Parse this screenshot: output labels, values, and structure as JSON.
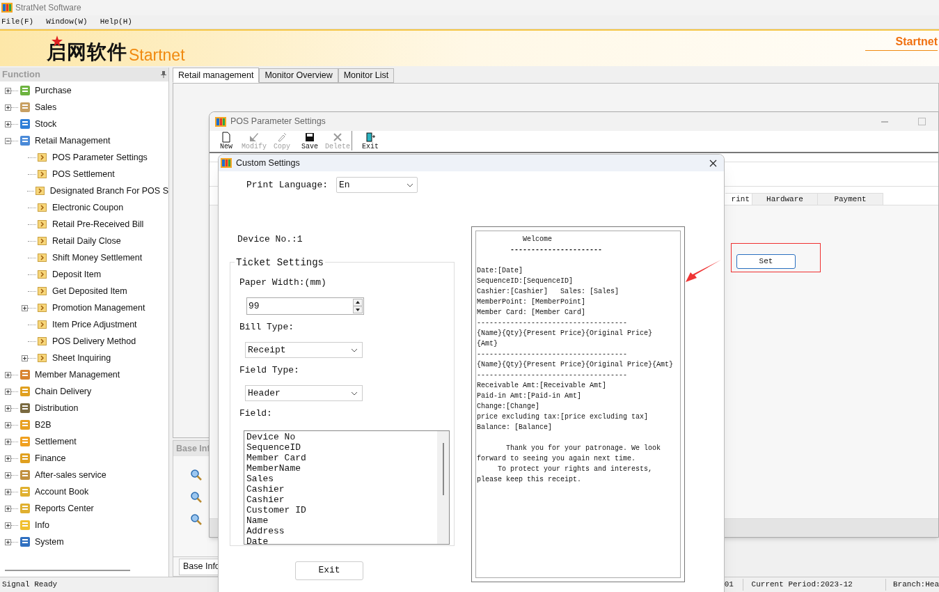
{
  "app": {
    "title": "StratNet Software"
  },
  "menu": [
    "File(F)",
    "Window(W)",
    "Help(H)"
  ],
  "banner": {
    "logo_cn": "启网软件",
    "logo_en": "Startnet",
    "right_text": "Startnet"
  },
  "sidebar": {
    "title": "Function",
    "items": [
      {
        "label": "Purchase",
        "expanded": false
      },
      {
        "label": "Sales",
        "expanded": false
      },
      {
        "label": "Stock",
        "expanded": false
      },
      {
        "label": "Retail Management",
        "expanded": true,
        "children": [
          {
            "label": "POS Parameter Settings",
            "expandable": false
          },
          {
            "label": "POS Settlement",
            "expandable": false
          },
          {
            "label": "Designated Branch For POS S",
            "expandable": false
          },
          {
            "label": "Electronic Coupon",
            "expandable": false
          },
          {
            "label": "Retail Pre-Received Bill",
            "expandable": false
          },
          {
            "label": "Retail Daily Close",
            "expandable": false
          },
          {
            "label": "Shift Money Settlement",
            "expandable": false
          },
          {
            "label": "Deposit Item",
            "expandable": false
          },
          {
            "label": "Get Deposited Item",
            "expandable": false
          },
          {
            "label": "Promotion Management",
            "expandable": true
          },
          {
            "label": "Item Price Adjustment",
            "expandable": false
          },
          {
            "label": "POS Delivery Method",
            "expandable": false
          },
          {
            "label": "Sheet Inquiring",
            "expandable": true
          }
        ]
      },
      {
        "label": "Member Management",
        "expanded": false
      },
      {
        "label": "Chain Delivery",
        "expanded": false
      },
      {
        "label": "Distribution",
        "expanded": false
      },
      {
        "label": "B2B",
        "expanded": false
      },
      {
        "label": "Settlement",
        "expanded": false
      },
      {
        "label": "Finance",
        "expanded": false
      },
      {
        "label": "After-sales service",
        "expanded": false
      },
      {
        "label": "Account Book",
        "expanded": false
      },
      {
        "label": "Reports Center",
        "expanded": false
      },
      {
        "label": "Info",
        "expanded": false
      },
      {
        "label": "System",
        "expanded": false
      }
    ]
  },
  "tabs": [
    {
      "label": "Retail management",
      "selected": true
    },
    {
      "label": "Monitor Overview",
      "selected": false
    },
    {
      "label": "Monitor List",
      "selected": false
    }
  ],
  "base_info": {
    "title": "Base Inf",
    "tab": "Base Info"
  },
  "pos_window": {
    "title": "POS Parameter Settings",
    "toolbar": [
      {
        "label": "New",
        "disabled": false
      },
      {
        "label": "Modify",
        "disabled": true
      },
      {
        "label": "Copy",
        "disabled": true
      },
      {
        "label": "Save",
        "disabled": false
      },
      {
        "label": "Delete",
        "disabled": true
      },
      {
        "label": "Exit",
        "disabled": false
      }
    ],
    "tabs": [
      {
        "label": "rint",
        "selected": true
      },
      {
        "label": "Hardware",
        "selected": false
      },
      {
        "label": "Payment",
        "selected": false
      }
    ],
    "set_button": "Set"
  },
  "dialog": {
    "title": "Custom Settings",
    "print_language": {
      "label": "Print Language:",
      "value": "En"
    },
    "device_no": "Device No.:1",
    "ticket_settings": {
      "title": "Ticket Settings",
      "paper_width": {
        "label": "Paper Width:(mm)",
        "value": "99"
      },
      "bill_type": {
        "label": "Bill Type:",
        "value": "Receipt"
      },
      "field_type": {
        "label": "Field Type:",
        "value": "Header"
      },
      "field": {
        "label": "Field:",
        "items": [
          "Device No",
          "SequenceID",
          "Member Card",
          "MemberName",
          "Sales",
          "Cashier",
          "Cashier",
          "Customer ID",
          "Name",
          "Address",
          "Date"
        ]
      }
    },
    "exit_button": "Exit",
    "receipt": [
      {
        "kind": "title",
        "text": "Welcome"
      },
      {
        "kind": "heading_rule",
        "text": "----------------------"
      },
      {
        "kind": "gap"
      },
      {
        "kind": "text",
        "text": "Date:[Date]"
      },
      {
        "kind": "text",
        "text": "SequenceID:[SequenceID]"
      },
      {
        "kind": "text",
        "text": "Cashier:[Cashier]   Sales: [Sales]"
      },
      {
        "kind": "text",
        "text": "MemberPoint: [MemberPoint]"
      },
      {
        "kind": "text",
        "text": "Member Card: [Member Card]"
      },
      {
        "kind": "text",
        "text": "------------------------------------"
      },
      {
        "kind": "text",
        "text": "{Name}{Qty}{Present Price}{Original Price}"
      },
      {
        "kind": "text",
        "text": "{Amt}"
      },
      {
        "kind": "text",
        "text": "------------------------------------"
      },
      {
        "kind": "text",
        "text": "{Name}{Qty}{Present Price}{Original Price}{Amt}"
      },
      {
        "kind": "text",
        "text": "------------------------------------"
      },
      {
        "kind": "text",
        "text": "Receivable Amt:[Receivable Amt]"
      },
      {
        "kind": "text",
        "text": "Paid-in Amt:[Paid-in Amt]"
      },
      {
        "kind": "text",
        "text": "Change:[Change]"
      },
      {
        "kind": "text",
        "text": "price excluding tax:[price excluding tax]"
      },
      {
        "kind": "text",
        "text": "Balance: [Balance]"
      },
      {
        "kind": "gap"
      },
      {
        "kind": "paragraph",
        "text": "       Thank you for your patronage. We look forward to seeing you again next time."
      },
      {
        "kind": "paragraph",
        "text": "     To protect your rights and interests, please keep this receipt."
      }
    ]
  },
  "status_bar": [
    "Signal Ready",
    "01",
    "Current Period:2023-12",
    "Branch:Hea"
  ]
}
